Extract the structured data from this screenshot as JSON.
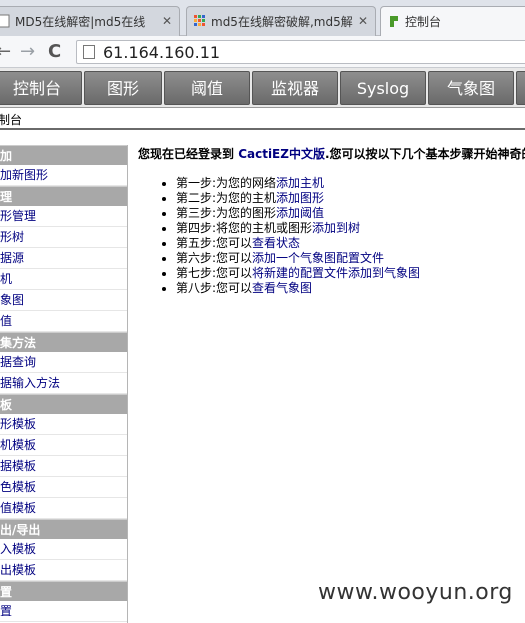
{
  "browser": {
    "tabs": [
      {
        "title": "MD5在线解密|md5在线",
        "icon": "page-icon",
        "active": false
      },
      {
        "title": "md5在线解密破解,md5解",
        "icon": "grid-favicon-icon",
        "active": false
      },
      {
        "title": "控制台",
        "icon": "cacti-favicon-icon",
        "active": true
      }
    ],
    "url": "61.164.160.11"
  },
  "nav": {
    "tabs": [
      "控制台",
      "图形",
      "阈值",
      "监视器",
      "Syslog",
      "气象图"
    ]
  },
  "breadcrumb": "制台",
  "sidebar": {
    "sections": [
      {
        "header": "添加",
        "items": [
          "添加新图形"
        ]
      },
      {
        "header": "管理",
        "items": [
          "图形管理",
          "图形树",
          "数据源",
          "主机",
          "气象图",
          "阈值"
        ]
      },
      {
        "header": "采集方法",
        "items": [
          "数据查询",
          "数据输入方法"
        ]
      },
      {
        "header": "模板",
        "items": [
          "图形模板",
          "主机模板",
          "数据模板",
          "颜色模板",
          "阈值模板"
        ]
      },
      {
        "header": "导出/导出",
        "items": [
          "导入模板",
          "导出模板"
        ]
      },
      {
        "header": "设置",
        "items": [
          "设置"
        ]
      }
    ]
  },
  "main": {
    "intro_prefix": "您现在已经登录到 ",
    "intro_brand": "CactiEZ中文版",
    "intro_suffix": ".您可以按以下几个基本步骤开始神奇的",
    "steps": [
      {
        "text": "第一步:为您的网络",
        "link": "添加主机"
      },
      {
        "text": "第二步:为您的主机",
        "link": "添加图形"
      },
      {
        "text": "第三步:为您的图形",
        "link": "添加阈值"
      },
      {
        "text": "第四步:将您的主机或图形",
        "link": "添加到树"
      },
      {
        "text": "第五步:您可以",
        "link": "查看状态"
      },
      {
        "text": "第六步:您可以",
        "link": "添加一个气象图配置文件"
      },
      {
        "text": "第七步:您可以",
        "link": "将新建的配置文件添加到气象图"
      },
      {
        "text": "第八步:您可以",
        "link": "查看气象图"
      }
    ]
  },
  "watermark": "www.wooyun.org"
}
